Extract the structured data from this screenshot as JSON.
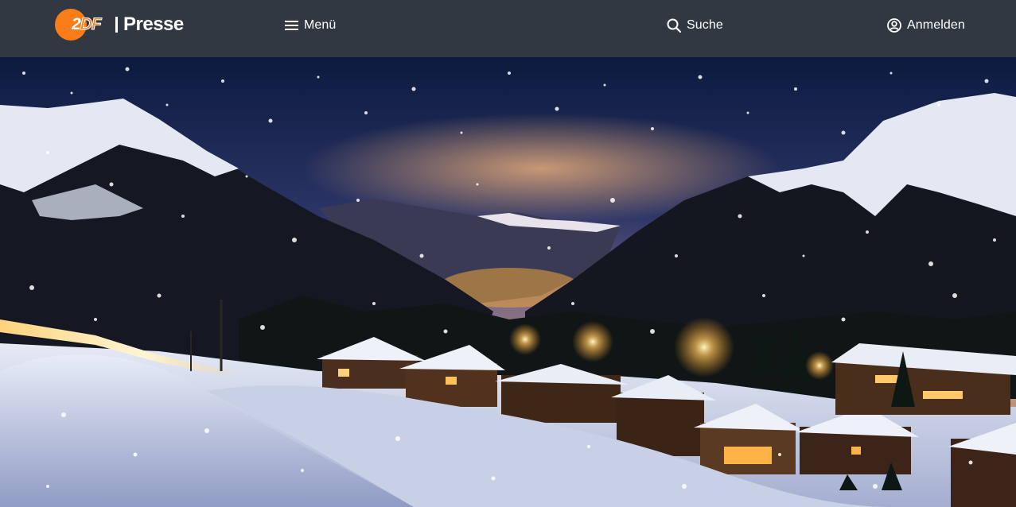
{
  "header": {
    "logo": {
      "brand": "ZDF",
      "brand_first": "2",
      "brand_rest": "DF",
      "section": "Presse",
      "circle_color": "#fa7d19"
    },
    "nav": {
      "menu_label": "Menü",
      "menu_icon": "hamburger-icon",
      "search_label": "Suche",
      "search_icon": "search-icon",
      "login_label": "Anmelden",
      "login_icon": "user-circle-icon"
    },
    "background_color": "#313842"
  },
  "hero": {
    "image_subject": "snowy-mountain-village-at-night"
  }
}
